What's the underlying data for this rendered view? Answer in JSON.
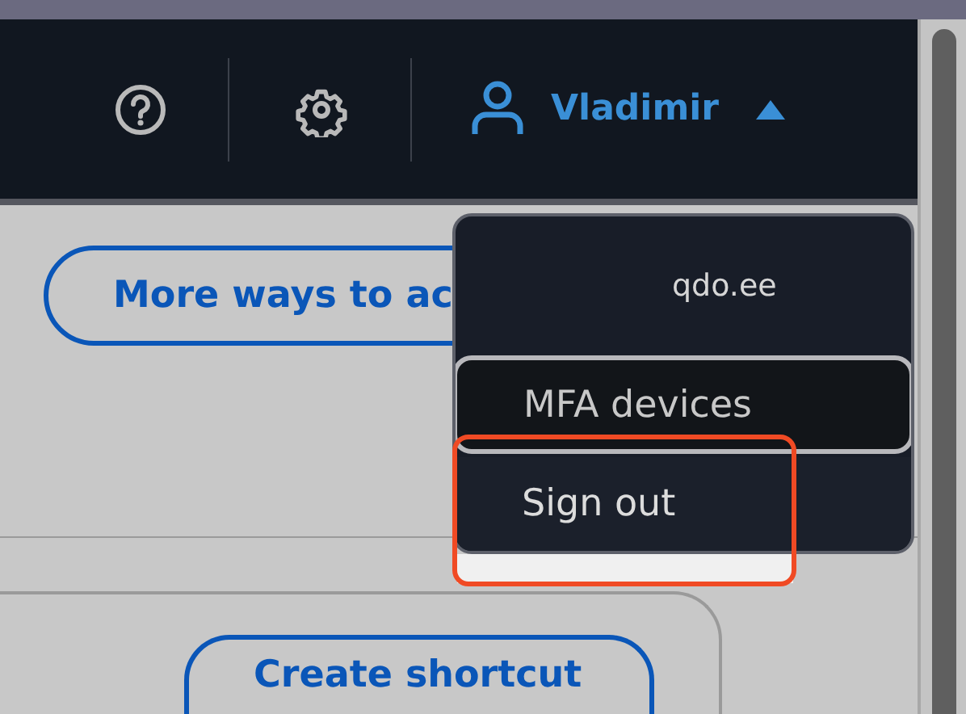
{
  "header": {
    "user": {
      "name": "Vladimir",
      "expanded": true
    }
  },
  "account_menu": {
    "account": "qdo.ee",
    "items": [
      {
        "label": "MFA devices",
        "selected": true
      },
      {
        "label": "Sign out",
        "selected": false
      }
    ]
  },
  "content": {
    "buttons": [
      "More ways to ac",
      "Create shortcut"
    ]
  }
}
